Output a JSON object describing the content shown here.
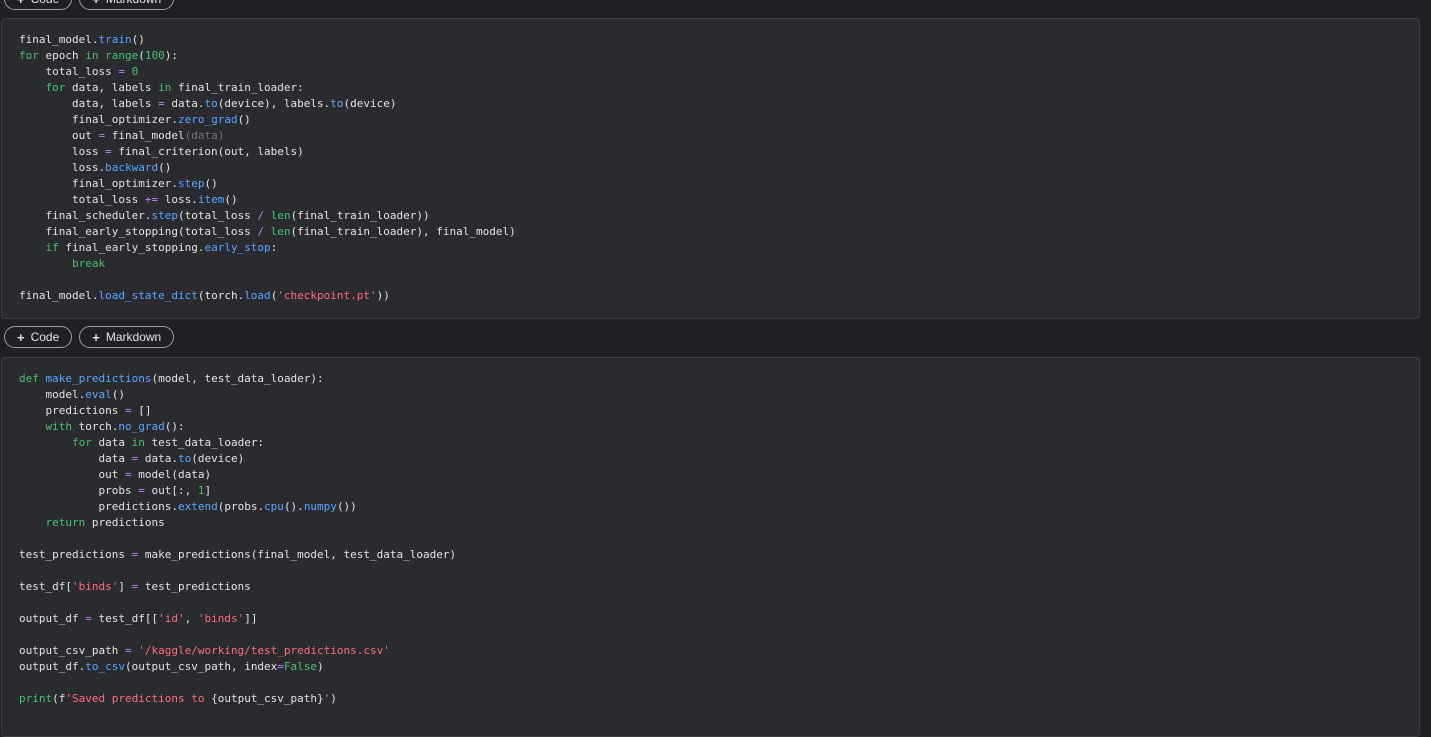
{
  "toolbar": {
    "add_code_label": "Code",
    "add_markdown_label": "Markdown",
    "plus_glyph": "+"
  },
  "colors": {
    "background": "#1f2023",
    "cell": "#2a2b2f",
    "keyword": "#45c36c",
    "function": "#58a6ff",
    "string": "#ff6b7a",
    "operator": "#c17cff",
    "text": "#e3e3e3"
  },
  "cells": [
    {
      "lines": [
        [
          [
            "final_model.",
            "p"
          ],
          [
            "train",
            "f"
          ],
          [
            "()",
            "p"
          ]
        ],
        [
          [
            "for",
            "k"
          ],
          [
            " epoch ",
            "p"
          ],
          [
            "in",
            "k"
          ],
          [
            " ",
            "p"
          ],
          [
            "range",
            "k"
          ],
          [
            "(",
            "p"
          ],
          [
            "100",
            "n"
          ],
          [
            "):",
            "p"
          ]
        ],
        [
          [
            "    total_loss ",
            "p"
          ],
          [
            "=",
            "o"
          ],
          [
            " ",
            "p"
          ],
          [
            "0",
            "n"
          ]
        ],
        [
          [
            "    ",
            "p"
          ],
          [
            "for",
            "k"
          ],
          [
            " data, labels ",
            "p"
          ],
          [
            "in",
            "k"
          ],
          [
            " final_train_loader:",
            "p"
          ]
        ],
        [
          [
            "        data, labels ",
            "p"
          ],
          [
            "=",
            "o"
          ],
          [
            " data.",
            "p"
          ],
          [
            "to",
            "f"
          ],
          [
            "(device), labels.",
            "p"
          ],
          [
            "to",
            "f"
          ],
          [
            "(device)",
            "p"
          ]
        ],
        [
          [
            "        final_optimizer.",
            "p"
          ],
          [
            "zero_grad",
            "f"
          ],
          [
            "()",
            "p"
          ]
        ],
        [
          [
            "        out ",
            "p"
          ],
          [
            "=",
            "o"
          ],
          [
            " final_model",
            "p"
          ],
          [
            "(data)",
            "d"
          ]
        ],
        [
          [
            "        loss ",
            "p"
          ],
          [
            "=",
            "o"
          ],
          [
            " final_criterion(out, labels)",
            "p"
          ]
        ],
        [
          [
            "        loss.",
            "p"
          ],
          [
            "backward",
            "f"
          ],
          [
            "()",
            "p"
          ]
        ],
        [
          [
            "        final_optimizer.",
            "p"
          ],
          [
            "step",
            "f"
          ],
          [
            "()",
            "p"
          ]
        ],
        [
          [
            "        total_loss ",
            "p"
          ],
          [
            "+=",
            "o"
          ],
          [
            " loss.",
            "p"
          ],
          [
            "item",
            "f"
          ],
          [
            "()",
            "p"
          ]
        ],
        [
          [
            "    final_scheduler.",
            "p"
          ],
          [
            "step",
            "f"
          ],
          [
            "(total_loss ",
            "p"
          ],
          [
            "/",
            "o"
          ],
          [
            " ",
            "p"
          ],
          [
            "len",
            "k"
          ],
          [
            "(final_train_loader))",
            "p"
          ]
        ],
        [
          [
            "    final_early_stopping(total_loss ",
            "p"
          ],
          [
            "/",
            "o"
          ],
          [
            " ",
            "p"
          ],
          [
            "len",
            "k"
          ],
          [
            "(final_train_loader), final_model)",
            "p"
          ]
        ],
        [
          [
            "    ",
            "p"
          ],
          [
            "if",
            "k"
          ],
          [
            " final_early_stopping.",
            "p"
          ],
          [
            "early_stop",
            "f"
          ],
          [
            ":",
            "p"
          ]
        ],
        [
          [
            "        ",
            "p"
          ],
          [
            "break",
            "k"
          ]
        ],
        [
          [
            "",
            "p"
          ]
        ],
        [
          [
            "final_model.",
            "p"
          ],
          [
            "load_state_dict",
            "f"
          ],
          [
            "(torch.",
            "p"
          ],
          [
            "load",
            "f"
          ],
          [
            "(",
            "p"
          ],
          [
            "'checkpoint.pt'",
            "s"
          ],
          [
            "))",
            "p"
          ]
        ]
      ]
    },
    {
      "lines": [
        [
          [
            "def",
            "k"
          ],
          [
            " ",
            "p"
          ],
          [
            "make_predictions",
            "f"
          ],
          [
            "(model, test_data_loader):",
            "p"
          ]
        ],
        [
          [
            "    model.",
            "p"
          ],
          [
            "eval",
            "f"
          ],
          [
            "()",
            "p"
          ]
        ],
        [
          [
            "    predictions ",
            "p"
          ],
          [
            "=",
            "o"
          ],
          [
            " []",
            "p"
          ]
        ],
        [
          [
            "    ",
            "p"
          ],
          [
            "with",
            "k"
          ],
          [
            " torch.",
            "p"
          ],
          [
            "no_grad",
            "f"
          ],
          [
            "():",
            "p"
          ]
        ],
        [
          [
            "        ",
            "p"
          ],
          [
            "for",
            "k"
          ],
          [
            " data ",
            "p"
          ],
          [
            "in",
            "k"
          ],
          [
            " test_data_loader:",
            "p"
          ]
        ],
        [
          [
            "            data ",
            "p"
          ],
          [
            "=",
            "o"
          ],
          [
            " data.",
            "p"
          ],
          [
            "to",
            "f"
          ],
          [
            "(device)",
            "p"
          ]
        ],
        [
          [
            "            out ",
            "p"
          ],
          [
            "=",
            "o"
          ],
          [
            " model(data)",
            "p"
          ]
        ],
        [
          [
            "            probs ",
            "p"
          ],
          [
            "=",
            "o"
          ],
          [
            " out[:, ",
            "p"
          ],
          [
            "1",
            "n"
          ],
          [
            "]",
            "p"
          ]
        ],
        [
          [
            "            predictions.",
            "p"
          ],
          [
            "extend",
            "f"
          ],
          [
            "(probs.",
            "p"
          ],
          [
            "cpu",
            "f"
          ],
          [
            "().",
            "p"
          ],
          [
            "numpy",
            "f"
          ],
          [
            "())",
            "p"
          ]
        ],
        [
          [
            "    ",
            "p"
          ],
          [
            "return",
            "k"
          ],
          [
            " predictions",
            "p"
          ]
        ],
        [
          [
            "",
            "p"
          ]
        ],
        [
          [
            "test_predictions ",
            "p"
          ],
          [
            "=",
            "o"
          ],
          [
            " make_predictions(final_model, test_data_loader)",
            "p"
          ]
        ],
        [
          [
            "",
            "p"
          ]
        ],
        [
          [
            "test_df[",
            "p"
          ],
          [
            "'binds'",
            "s"
          ],
          [
            "] ",
            "p"
          ],
          [
            "=",
            "o"
          ],
          [
            " test_predictions",
            "p"
          ]
        ],
        [
          [
            "",
            "p"
          ]
        ],
        [
          [
            "output_df ",
            "p"
          ],
          [
            "=",
            "o"
          ],
          [
            " test_df[[",
            "p"
          ],
          [
            "'id'",
            "s"
          ],
          [
            ", ",
            "p"
          ],
          [
            "'binds'",
            "s"
          ],
          [
            "]]",
            "p"
          ]
        ],
        [
          [
            "",
            "p"
          ]
        ],
        [
          [
            "output_csv_path ",
            "p"
          ],
          [
            "=",
            "o"
          ],
          [
            " ",
            "p"
          ],
          [
            "'/kaggle/working/test_predictions.csv'",
            "s"
          ]
        ],
        [
          [
            "output_df.",
            "p"
          ],
          [
            "to_csv",
            "f"
          ],
          [
            "(output_csv_path, index",
            "p"
          ],
          [
            "=",
            "o"
          ],
          [
            "False",
            "k"
          ],
          [
            ")",
            "p"
          ]
        ],
        [
          [
            "",
            "p"
          ]
        ],
        [
          [
            "print",
            "k"
          ],
          [
            "(f",
            "p"
          ],
          [
            "'Saved predictions to ",
            "s"
          ],
          [
            "{output_csv_path}",
            "p"
          ],
          [
            "'",
            "s"
          ],
          [
            ")",
            "p"
          ]
        ]
      ]
    }
  ]
}
